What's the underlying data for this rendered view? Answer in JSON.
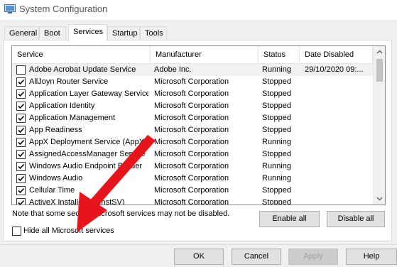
{
  "window": {
    "title": "System Configuration",
    "icon": "msconfig-icon"
  },
  "tabs": [
    {
      "label": "General"
    },
    {
      "label": "Boot"
    },
    {
      "label": "Services",
      "active": true
    },
    {
      "label": "Startup"
    },
    {
      "label": "Tools"
    }
  ],
  "services": {
    "columns": [
      "Service",
      "Manufacturer",
      "Status",
      "Date Disabled"
    ],
    "rows": [
      {
        "checked": false,
        "name": "Adobe Acrobat Update Service",
        "manufacturer": "Adobe Inc.",
        "status": "Running",
        "date_disabled": "29/10/2020 09:..."
      },
      {
        "checked": true,
        "name": "AllJoyn Router Service",
        "manufacturer": "Microsoft Corporation",
        "status": "Stopped",
        "date_disabled": ""
      },
      {
        "checked": true,
        "name": "Application Layer Gateway Service",
        "manufacturer": "Microsoft Corporation",
        "status": "Stopped",
        "date_disabled": ""
      },
      {
        "checked": true,
        "name": "Application Identity",
        "manufacturer": "Microsoft Corporation",
        "status": "Stopped",
        "date_disabled": ""
      },
      {
        "checked": true,
        "name": "Application Management",
        "manufacturer": "Microsoft Corporation",
        "status": "Stopped",
        "date_disabled": ""
      },
      {
        "checked": true,
        "name": "App Readiness",
        "manufacturer": "Microsoft Corporation",
        "status": "Stopped",
        "date_disabled": ""
      },
      {
        "checked": true,
        "name": "AppX Deployment Service (AppX...",
        "manufacturer": "Microsoft Corporation",
        "status": "Running",
        "date_disabled": ""
      },
      {
        "checked": true,
        "name": "AssignedAccessManager Service",
        "manufacturer": "Microsoft Corporation",
        "status": "Stopped",
        "date_disabled": ""
      },
      {
        "checked": true,
        "name": "Windows Audio Endpoint Builder",
        "manufacturer": "Microsoft Corporation",
        "status": "Running",
        "date_disabled": ""
      },
      {
        "checked": true,
        "name": "Windows Audio",
        "manufacturer": "Microsoft Corporation",
        "status": "Running",
        "date_disabled": ""
      },
      {
        "checked": true,
        "name": "Cellular Time",
        "manufacturer": "Microsoft Corporation",
        "status": "Stopped",
        "date_disabled": ""
      },
      {
        "checked": true,
        "name": "ActiveX Installer (AxInstSV)",
        "manufacturer": "Microsoft Corporation",
        "status": "Stopped",
        "date_disabled": ""
      }
    ]
  },
  "note": "Note that some secure Microsoft services may not be disabled.",
  "buttons": {
    "enable_all": "Enable all",
    "disable_all": "Disable all",
    "ok": "OK",
    "cancel": "Cancel",
    "apply": "Apply",
    "help": "Help"
  },
  "hide_ms": {
    "label": "Hide all Microsoft services",
    "checked": false
  },
  "colors": {
    "arrow": "#e8141c",
    "selection": "#f1f1f1"
  }
}
